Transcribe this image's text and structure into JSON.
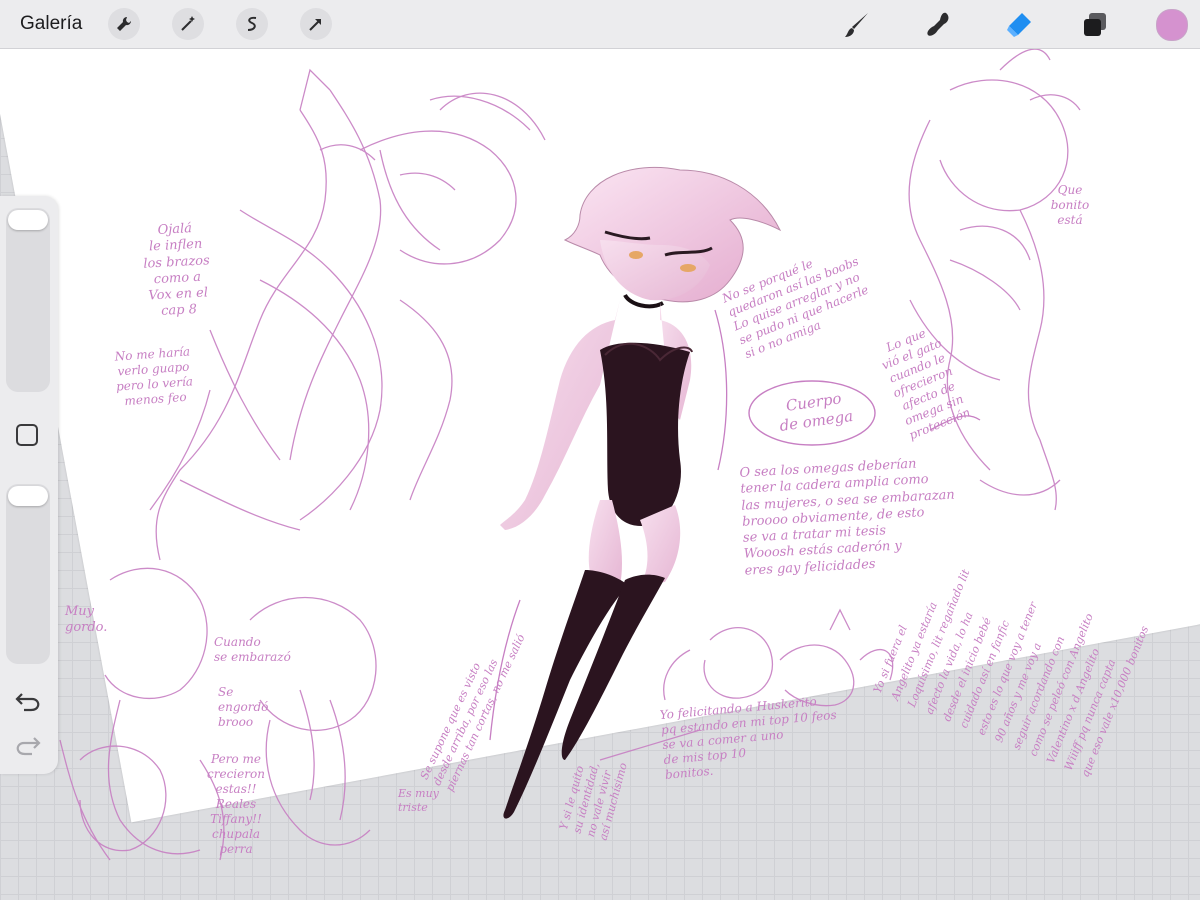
{
  "app": {
    "gallery_label": "Galería"
  },
  "toolbar": {
    "left_tools": [
      "wrench-icon",
      "magic-wand-icon",
      "selection-icon",
      "transform-arrow-icon"
    ],
    "right_tools": [
      "brush-icon",
      "smudge-icon",
      "eraser-icon",
      "layers-icon"
    ],
    "active_tool": "eraser",
    "active_color": "#d592cf"
  },
  "sidebar": {
    "brush_size_level": 0.02,
    "opacity_level": 0.02,
    "undo_icon": "undo-icon",
    "redo_icon": "redo-icon"
  },
  "sketch_color": "#c77fc3",
  "notes": {
    "ojala": "Ojalá\nle inflen\nlos brazos\ncomo a\nVox en el\ncap 8",
    "guapo": "No me haría\nverlo guapo\npero lo vería\nmenos feo",
    "no_se_porque": "No se porqué le\nquedaron así las boobs\nLo quise arreglar y no\nse pudo ni que hacerle\nsi o no amiga",
    "cuerpo": "Cuerpo\nde omega",
    "lo_que": "Lo que\nvió el gato\ncuando le\nofrecieron\nafecto de\nomega sin\nprotección",
    "que_bonito": "Que\nbonito\nestá",
    "o_sea": "O sea los omegas deberían\ntener la cadera amplia como\nlas mujeres, o sea se embarazan\nbroooo obviamente, de esto\nse va a tratar mi tesis\nWooosh estás caderón y\neres gay felicidades",
    "muy_gordo": "Muy\ngordo.",
    "cuando": "Cuando\nse embarazó",
    "engordo": "Se\nengordó\nbrooo",
    "pero_me": "Pero me\ncrecieron\nestas!!\nReales\nTiffany!!\nchupala\nperra",
    "se_supone": "Se supone que es visto\ndesde arriba, por eso las\npiernas tan cortas, no me salió",
    "muy_triste": "Es muy\ntriste",
    "si_le_quito": "Y si le quito\nsu identidad,\nno vale vivir\nasí muchísimo",
    "yo_felicitando": "Yo felicitando a Huskerito\npq estando en mi top 10 feos\nse va a comer a uno\nde mis top 10\nbonitos.",
    "si_fuera": "Yo si fuera el\nAngelito ya estaría\nLoquísimo, lit regañado lit\nafecto la vida, lo ha\ndesde el inicio bebé\ncuidado así en fanfic\nesto es lo que voy a tener\n90 años y me voy a\nseguir acordando con\ncomo se peleó con Angelito\nValentino x d Angelito\nWiiiff pq nunca capta\nque eso vale x10,000 bonitos"
  }
}
